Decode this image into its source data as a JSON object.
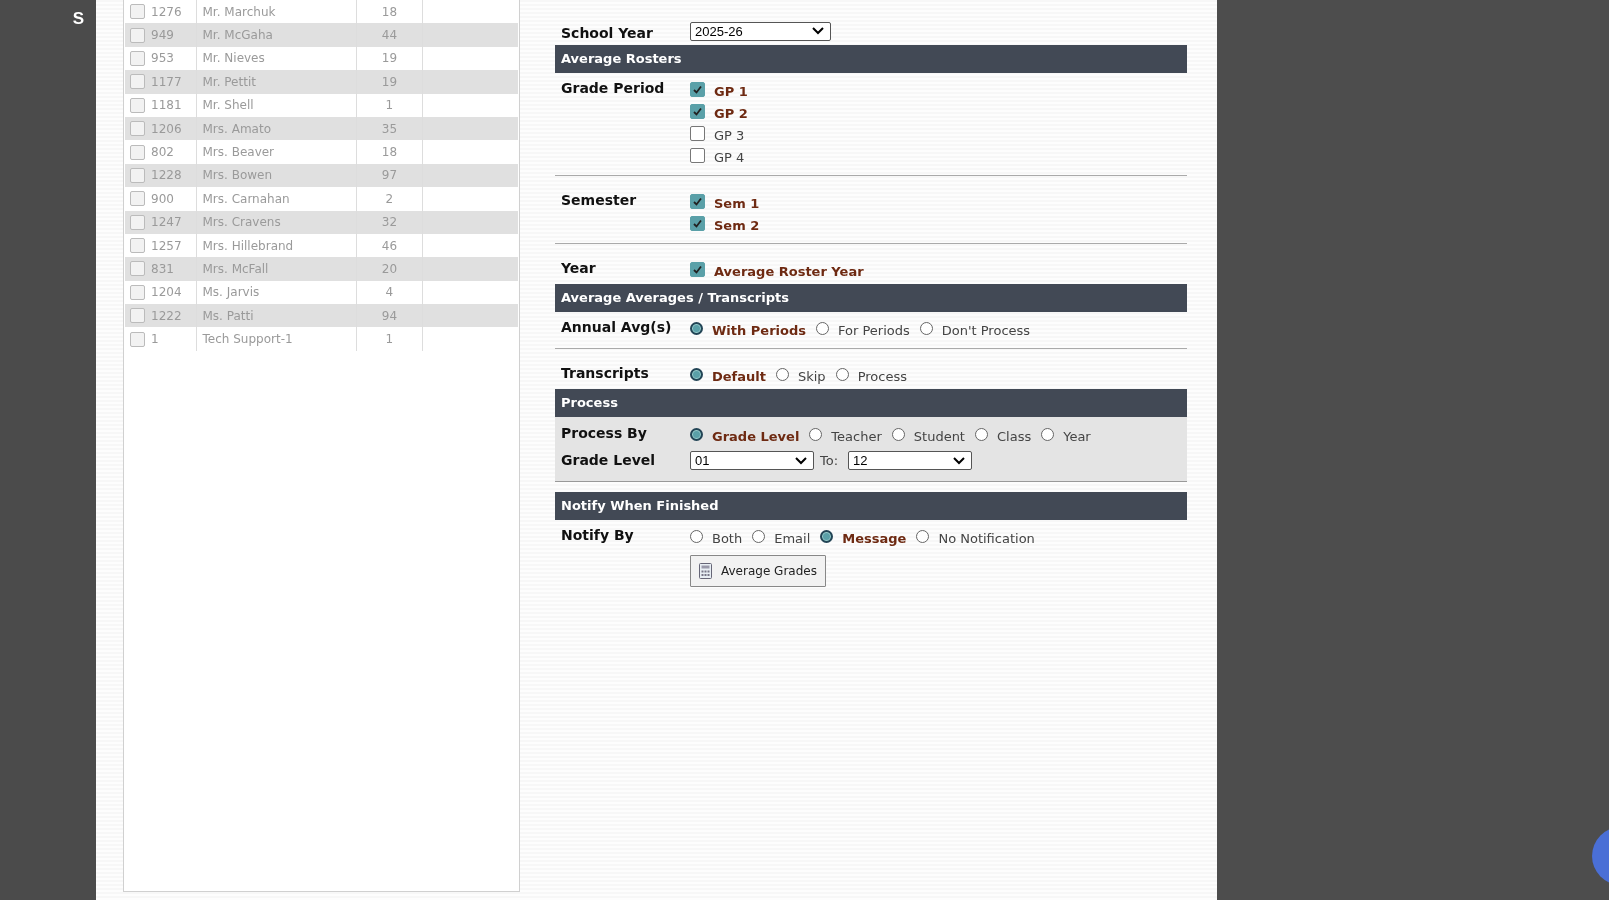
{
  "sidebar": {
    "letter": "S"
  },
  "roster": {
    "rows": [
      {
        "checked": false,
        "id": "1276",
        "name": "Mr. Marchuk",
        "count": "18"
      },
      {
        "checked": false,
        "id": "949",
        "name": "Mr. McGaha",
        "count": "44"
      },
      {
        "checked": false,
        "id": "953",
        "name": "Mr. Nieves",
        "count": "19"
      },
      {
        "checked": false,
        "id": "1177",
        "name": "Mr. Pettit",
        "count": "19"
      },
      {
        "checked": false,
        "id": "1181",
        "name": "Mr. Shell",
        "count": "1"
      },
      {
        "checked": false,
        "id": "1206",
        "name": "Mrs. Amato",
        "count": "35"
      },
      {
        "checked": false,
        "id": "802",
        "name": "Mrs. Beaver",
        "count": "18"
      },
      {
        "checked": false,
        "id": "1228",
        "name": "Mrs. Bowen",
        "count": "97"
      },
      {
        "checked": false,
        "id": "900",
        "name": "Mrs. Carnahan",
        "count": "2"
      },
      {
        "checked": false,
        "id": "1247",
        "name": "Mrs. Cravens",
        "count": "32"
      },
      {
        "checked": false,
        "id": "1257",
        "name": "Mrs. Hillebrand",
        "count": "46"
      },
      {
        "checked": false,
        "id": "831",
        "name": "Mrs. McFall",
        "count": "20"
      },
      {
        "checked": false,
        "id": "1204",
        "name": "Ms. Jarvis",
        "count": "4"
      },
      {
        "checked": false,
        "id": "1222",
        "name": "Ms. Patti",
        "count": "94"
      },
      {
        "checked": false,
        "id": "1",
        "name": "Tech Support-1",
        "count": "1"
      }
    ]
  },
  "form": {
    "school_year": {
      "label": "School Year",
      "value": "2025-26"
    },
    "sections": [
      {
        "title": "Average Rosters",
        "shaded": false,
        "rows": [
          {
            "kind": "checks",
            "label": "Grade Period",
            "options": [
              {
                "label": "GP 1",
                "checked": true
              },
              {
                "label": "GP 2",
                "checked": true
              },
              {
                "label": "GP 3",
                "checked": false
              },
              {
                "label": "GP 4",
                "checked": false
              }
            ]
          },
          {
            "kind": "checks",
            "label": "Semester",
            "options": [
              {
                "label": "Sem 1",
                "checked": true
              },
              {
                "label": "Sem 2",
                "checked": true
              }
            ]
          },
          {
            "kind": "checks",
            "label": "Year",
            "options": [
              {
                "label": "Average Roster Year",
                "checked": true
              }
            ]
          }
        ]
      },
      {
        "title": "Average Averages / Transcripts",
        "shaded": false,
        "rows": [
          {
            "kind": "radios",
            "label": "Annual Avg(s)",
            "options": [
              {
                "label": "With Periods",
                "selected": true
              },
              {
                "label": "For Periods",
                "selected": false
              },
              {
                "label": "Don't Process",
                "selected": false
              }
            ]
          },
          {
            "kind": "radios",
            "label": "Transcripts",
            "options": [
              {
                "label": "Default",
                "selected": true
              },
              {
                "label": "Skip",
                "selected": false
              },
              {
                "label": "Process",
                "selected": false
              }
            ]
          }
        ]
      },
      {
        "title": "Process",
        "shaded": true,
        "rows": [
          {
            "kind": "radios",
            "label": "Process By",
            "options": [
              {
                "label": "Grade Level",
                "selected": true
              },
              {
                "label": "Teacher",
                "selected": false
              },
              {
                "label": "Student",
                "selected": false
              },
              {
                "label": "Class",
                "selected": false
              },
              {
                "label": "Year",
                "selected": false
              }
            ]
          },
          {
            "kind": "range",
            "label": "Grade Level",
            "from": "01",
            "to_label": "To:",
            "to": "12"
          }
        ]
      },
      {
        "title": "Notify When Finished",
        "shaded": false,
        "rows": [
          {
            "kind": "radios",
            "label": "Notify By",
            "options": [
              {
                "label": "Both",
                "selected": false
              },
              {
                "label": "Email",
                "selected": false
              },
              {
                "label": "Message",
                "selected": true
              },
              {
                "label": "No Notification",
                "selected": false
              }
            ]
          }
        ]
      }
    ],
    "button": "Average Grades"
  }
}
